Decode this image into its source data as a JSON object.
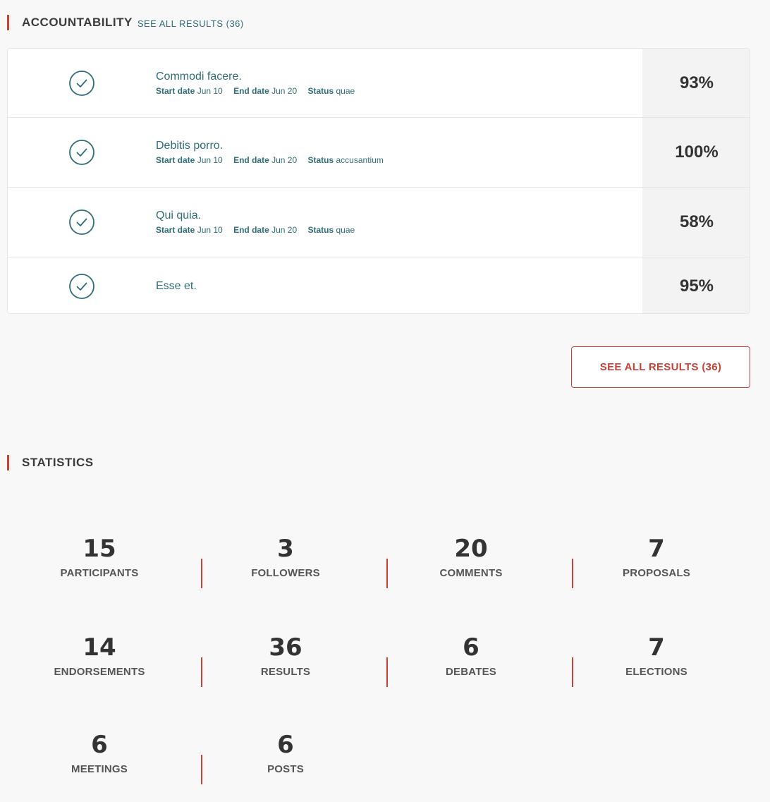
{
  "accountability": {
    "title": "ACCOUNTABILITY",
    "see_all_link": "SEE ALL RESULTS (36)",
    "results": [
      {
        "title": "Commodi facere.",
        "start_label": "Start date",
        "start_value": "Jun 10",
        "end_label": "End date",
        "end_value": "Jun 20",
        "status_label": "Status",
        "status_value": "quae",
        "progress": "93%"
      },
      {
        "title": "Debitis porro.",
        "start_label": "Start date",
        "start_value": "Jun 10",
        "end_label": "End date",
        "end_value": "Jun 20",
        "status_label": "Status",
        "status_value": "accusantium",
        "progress": "100%"
      },
      {
        "title": "Qui quia.",
        "start_label": "Start date",
        "start_value": "Jun 10",
        "end_label": "End date",
        "end_value": "Jun 20",
        "status_label": "Status",
        "status_value": "quae",
        "progress": "58%"
      },
      {
        "title": "Esse et.",
        "progress": "95%"
      }
    ],
    "see_all_button": "SEE ALL RESULTS (36)"
  },
  "statistics": {
    "title": "STATISTICS",
    "items": [
      {
        "value": "15",
        "label": "PARTICIPANTS"
      },
      {
        "value": "3",
        "label": "FOLLOWERS"
      },
      {
        "value": "20",
        "label": "COMMENTS"
      },
      {
        "value": "7",
        "label": "PROPOSALS"
      },
      {
        "value": "14",
        "label": "ENDORSEMENTS"
      },
      {
        "value": "36",
        "label": "RESULTS"
      },
      {
        "value": "6",
        "label": "DEBATES"
      },
      {
        "value": "7",
        "label": "ELECTIONS"
      },
      {
        "value": "6",
        "label": "MEETINGS"
      },
      {
        "value": "6",
        "label": "POSTS"
      }
    ]
  },
  "colors": {
    "accent": "#c8423a",
    "link": "#2f6e77",
    "text": "#333333"
  },
  "icons": {
    "result_icon": "check-circle-icon"
  }
}
